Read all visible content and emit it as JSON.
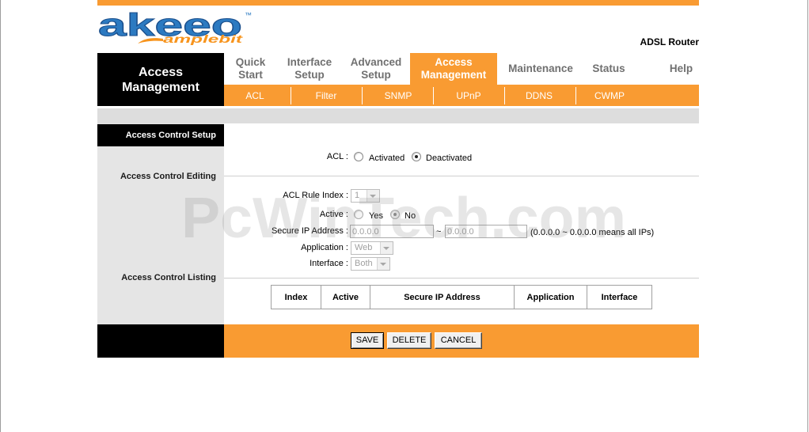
{
  "logo": {
    "name": "akeeo",
    "trademark": "™",
    "tagline": "amplebit"
  },
  "header": {
    "product": "ADSL Router"
  },
  "section": {
    "title_lines": [
      "Access",
      "Management"
    ]
  },
  "nav": {
    "tabs": [
      {
        "label_lines": [
          "Quick",
          "Start"
        ]
      },
      {
        "label_lines": [
          "Interface",
          "Setup"
        ]
      },
      {
        "label_lines": [
          "Advanced",
          "Setup"
        ]
      },
      {
        "label_lines": [
          "Access",
          "Management"
        ],
        "active": true
      },
      {
        "label_lines": [
          "Maintenance"
        ]
      },
      {
        "label_lines": [
          "Status"
        ]
      },
      {
        "label_lines": [
          "Help"
        ]
      }
    ]
  },
  "subnav": {
    "items": [
      "ACL",
      "Filter",
      "SNMP",
      "UPnP",
      "DDNS",
      "CWMP"
    ]
  },
  "sidebar": {
    "setup_title": "Access Control Setup",
    "editing_label": "Access Control Editing",
    "listing_label": "Access Control Listing"
  },
  "acl": {
    "label": "ACL :",
    "options": [
      {
        "label": "Activated",
        "checked": false
      },
      {
        "label": "Deactivated",
        "checked": true
      }
    ]
  },
  "editing": {
    "rule_index": {
      "label": "ACL Rule Index :",
      "value": "1",
      "disabled": true
    },
    "active": {
      "label": "Active :",
      "options": [
        {
          "label": "Yes",
          "checked": false
        },
        {
          "label": "No",
          "checked": true
        }
      ],
      "disabled": true
    },
    "secure_ip": {
      "label": "Secure IP Address :",
      "start": "0.0.0.0",
      "separator": "~",
      "end": "0.0.0.0",
      "hint": "(0.0.0.0 ~ 0.0.0.0 means all IPs)",
      "disabled": true
    },
    "application": {
      "label": "Application :",
      "value": "Web",
      "disabled": true
    },
    "interface": {
      "label": "Interface :",
      "value": "Both",
      "disabled": true
    }
  },
  "listing": {
    "columns": [
      "Index",
      "Active",
      "Secure IP Address",
      "Application",
      "Interface"
    ]
  },
  "actions": {
    "save": "SAVE",
    "delete": "DELETE",
    "cancel": "CANCEL"
  },
  "watermark": "PcWinTech.com",
  "colors": {
    "accent": "#F99B32",
    "nav_text": "#707070",
    "sidebar_bg": "#E5E5E5",
    "band_bg": "#DDDDDD",
    "logo_blue": "#2C7AC1",
    "logo_orange": "#F7941D",
    "rule": "#CFCFCF"
  }
}
